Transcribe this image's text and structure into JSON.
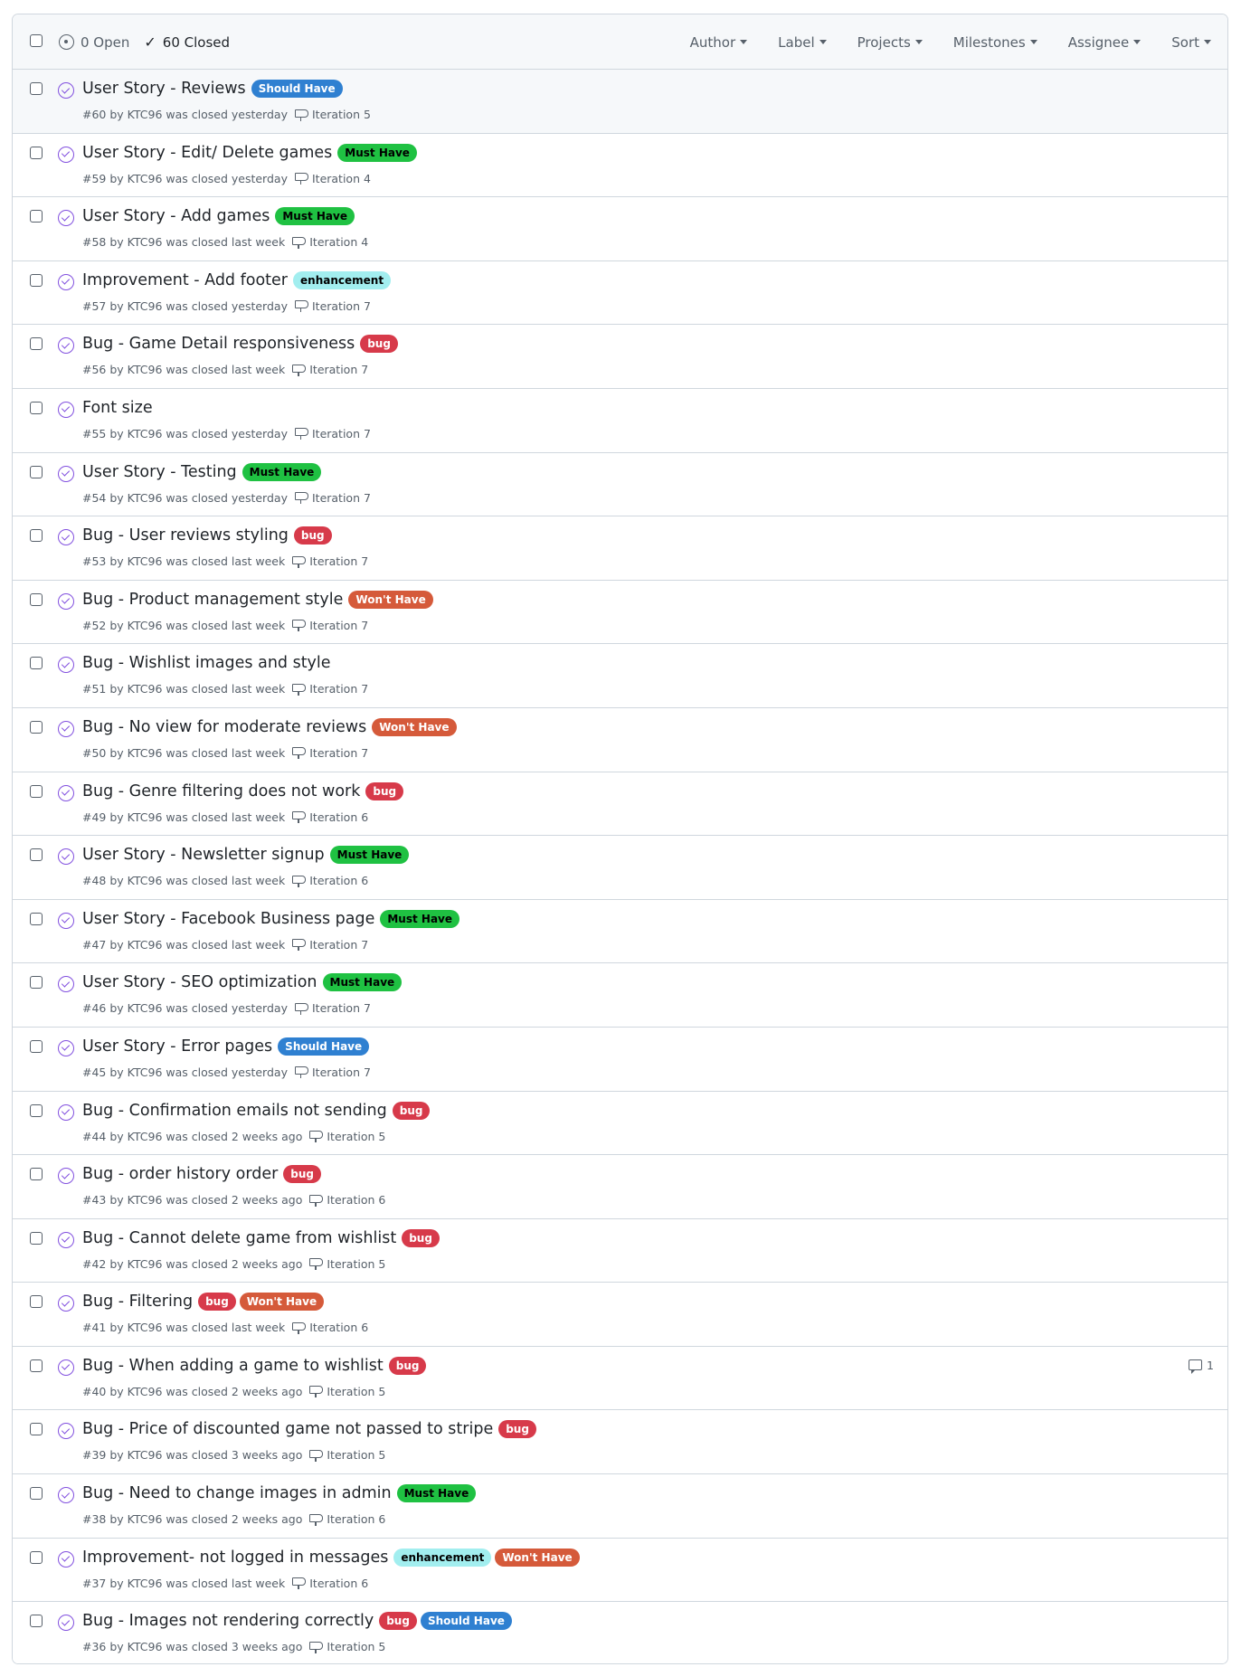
{
  "header": {
    "open_label": "0 Open",
    "closed_label": "60 Closed",
    "filters": [
      "Author",
      "Label",
      "Projects",
      "Milestones",
      "Assignee",
      "Sort"
    ]
  },
  "label_colors": {
    "Should Have": {
      "bg": "#2f80d1",
      "fg": "#ffffff"
    },
    "Must Have": {
      "bg": "#1fc142",
      "fg": "#000000"
    },
    "enhancement": {
      "bg": "#a2eeef",
      "fg": "#000000"
    },
    "bug": {
      "bg": "#d73a4a",
      "fg": "#ffffff"
    },
    "Won't Have": {
      "bg": "#d55a3a",
      "fg": "#ffffff"
    }
  },
  "issues": [
    {
      "title": "User Story - Reviews",
      "labels": [
        "Should Have"
      ],
      "meta": "#60 by KTC96 was closed yesterday",
      "milestone": "Iteration 5",
      "comments": null
    },
    {
      "title": "User Story - Edit/ Delete games",
      "labels": [
        "Must Have"
      ],
      "meta": "#59 by KTC96 was closed yesterday",
      "milestone": "Iteration 4",
      "comments": null
    },
    {
      "title": "User Story - Add games",
      "labels": [
        "Must Have"
      ],
      "meta": "#58 by KTC96 was closed last week",
      "milestone": "Iteration 4",
      "comments": null
    },
    {
      "title": "Improvement - Add footer",
      "labels": [
        "enhancement"
      ],
      "meta": "#57 by KTC96 was closed yesterday",
      "milestone": "Iteration 7",
      "comments": null
    },
    {
      "title": "Bug - Game Detail responsiveness",
      "labels": [
        "bug"
      ],
      "meta": "#56 by KTC96 was closed last week",
      "milestone": "Iteration 7",
      "comments": null
    },
    {
      "title": "Font size",
      "labels": [],
      "meta": "#55 by KTC96 was closed yesterday",
      "milestone": "Iteration 7",
      "comments": null
    },
    {
      "title": "User Story - Testing",
      "labels": [
        "Must Have"
      ],
      "meta": "#54 by KTC96 was closed yesterday",
      "milestone": "Iteration 7",
      "comments": null
    },
    {
      "title": "Bug - User reviews styling",
      "labels": [
        "bug"
      ],
      "meta": "#53 by KTC96 was closed last week",
      "milestone": "Iteration 7",
      "comments": null
    },
    {
      "title": "Bug - Product management style",
      "labels": [
        "Won't Have"
      ],
      "meta": "#52 by KTC96 was closed last week",
      "milestone": "Iteration 7",
      "comments": null
    },
    {
      "title": "Bug - Wishlist images and style",
      "labels": [],
      "meta": "#51 by KTC96 was closed last week",
      "milestone": "Iteration 7",
      "comments": null
    },
    {
      "title": "Bug - No view for moderate reviews",
      "labels": [
        "Won't Have"
      ],
      "meta": "#50 by KTC96 was closed last week",
      "milestone": "Iteration 7",
      "comments": null
    },
    {
      "title": "Bug - Genre filtering does not work",
      "labels": [
        "bug"
      ],
      "meta": "#49 by KTC96 was closed last week",
      "milestone": "Iteration 6",
      "comments": null
    },
    {
      "title": "User Story - Newsletter signup",
      "labels": [
        "Must Have"
      ],
      "meta": "#48 by KTC96 was closed last week",
      "milestone": "Iteration 6",
      "comments": null
    },
    {
      "title": "User Story - Facebook Business page",
      "labels": [
        "Must Have"
      ],
      "meta": "#47 by KTC96 was closed last week",
      "milestone": "Iteration 7",
      "comments": null
    },
    {
      "title": "User Story - SEO optimization",
      "labels": [
        "Must Have"
      ],
      "meta": "#46 by KTC96 was closed yesterday",
      "milestone": "Iteration 7",
      "comments": null
    },
    {
      "title": "User Story - Error pages",
      "labels": [
        "Should Have"
      ],
      "meta": "#45 by KTC96 was closed yesterday",
      "milestone": "Iteration 7",
      "comments": null
    },
    {
      "title": "Bug - Confirmation emails not sending",
      "labels": [
        "bug"
      ],
      "meta": "#44 by KTC96 was closed 2 weeks ago",
      "milestone": "Iteration 5",
      "comments": null
    },
    {
      "title": "Bug - order history order",
      "labels": [
        "bug"
      ],
      "meta": "#43 by KTC96 was closed 2 weeks ago",
      "milestone": "Iteration 6",
      "comments": null
    },
    {
      "title": "Bug - Cannot delete game from wishlist",
      "labels": [
        "bug"
      ],
      "meta": "#42 by KTC96 was closed 2 weeks ago",
      "milestone": "Iteration 5",
      "comments": null
    },
    {
      "title": "Bug - Filtering",
      "labels": [
        "bug",
        "Won't Have"
      ],
      "meta": "#41 by KTC96 was closed last week",
      "milestone": "Iteration 6",
      "comments": null
    },
    {
      "title": "Bug - When adding a game to wishlist",
      "labels": [
        "bug"
      ],
      "meta": "#40 by KTC96 was closed 2 weeks ago",
      "milestone": "Iteration 5",
      "comments": "1"
    },
    {
      "title": "Bug - Price of discounted game not passed to stripe",
      "labels": [
        "bug"
      ],
      "meta": "#39 by KTC96 was closed 3 weeks ago",
      "milestone": "Iteration 5",
      "comments": null
    },
    {
      "title": "Bug - Need to change images in admin",
      "labels": [
        "Must Have"
      ],
      "meta": "#38 by KTC96 was closed 2 weeks ago",
      "milestone": "Iteration 6",
      "comments": null
    },
    {
      "title": "Improvement- not logged in messages",
      "labels": [
        "enhancement",
        "Won't Have"
      ],
      "meta": "#37 by KTC96 was closed last week",
      "milestone": "Iteration 6",
      "comments": null
    },
    {
      "title": "Bug - Images not rendering correctly",
      "labels": [
        "bug",
        "Should Have"
      ],
      "meta": "#36 by KTC96 was closed 3 weeks ago",
      "milestone": "Iteration 5",
      "comments": null
    }
  ]
}
